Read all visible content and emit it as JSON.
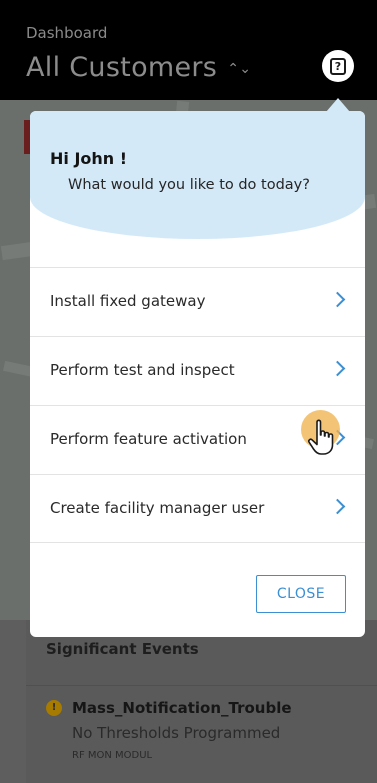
{
  "header": {
    "subtitle": "Dashboard",
    "title": "All Customers",
    "title_chevron": "⌃⌄",
    "help_icon": "?"
  },
  "events": {
    "title": "Significant Events",
    "item": {
      "name": "Mass_Notification_Trouble",
      "detail": "No Thresholds Programmed",
      "device": "RF MON MODUL",
      "icon": "warning-icon"
    }
  },
  "popup": {
    "greeting": "Hi John !",
    "prompt": "What would you like to do today?",
    "menu": [
      {
        "label": "Install fixed gateway"
      },
      {
        "label": "Perform test and inspect"
      },
      {
        "label": "Perform feature activation"
      },
      {
        "label": "Create facility manager user"
      }
    ],
    "close_label": "CLOSE"
  },
  "colors": {
    "accent": "#3b8fd2",
    "hero": "#d4e9f7",
    "tap": "#f0b450"
  }
}
